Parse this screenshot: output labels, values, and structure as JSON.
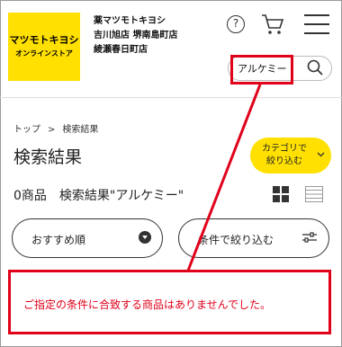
{
  "header": {
    "logo_line1": "マツモトキヨシ",
    "logo_line2": "オンラインストア",
    "store_lines": [
      "薬マツモトキヨシ",
      "吉川旭店 堺南島町店",
      "綾瀬春日町店"
    ],
    "help_symbol": "?",
    "search_value": "アルケミー"
  },
  "breadcrumb": {
    "home": "トップ",
    "separator": ">",
    "current": "検索結果"
  },
  "page_title": "検索結果",
  "category_button": {
    "line1": "カテゴリで",
    "line2": "絞り込む"
  },
  "results": {
    "count": "0商品",
    "query": "検索結果\"アルケミー\""
  },
  "sort_button": {
    "label": "おすすめ順"
  },
  "filter_button": {
    "label": "条件で絞り込む"
  },
  "message": "ご指定の条件に合致する商品はありませんでした。",
  "colors": {
    "brand_yellow": "#ffe000",
    "highlight_red": "#e0001a"
  },
  "icons": [
    "help-icon",
    "cart-icon",
    "menu-icon",
    "search-icon",
    "chevron-down-icon",
    "grid-view-icon",
    "list-view-icon",
    "filter-icon"
  ]
}
